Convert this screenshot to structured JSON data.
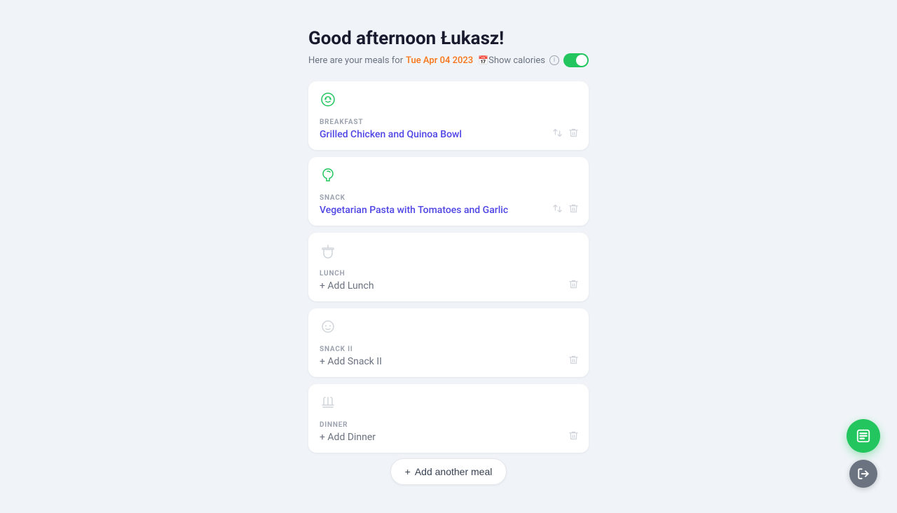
{
  "header": {
    "greeting": "Good afternoon Łukasz!",
    "subtitle_prefix": "Here are your meals for",
    "date": "Tue Apr 04 2023",
    "show_calories_label": "Show calories",
    "calories_toggle_on": true
  },
  "meals": [
    {
      "id": "breakfast",
      "type_label": "BREAKFAST",
      "meal_name": "Grilled Chicken and Quinoa Bowl",
      "is_empty": false,
      "icon": "breakfast-icon",
      "actions": [
        "swap",
        "delete"
      ]
    },
    {
      "id": "snack",
      "type_label": "SNACK",
      "meal_name": "Vegetarian Pasta with Tomatoes and Garlic",
      "is_empty": false,
      "icon": "snack-icon",
      "actions": [
        "swap",
        "delete"
      ]
    },
    {
      "id": "lunch",
      "type_label": "LUNCH",
      "meal_name": "+ Add Lunch",
      "is_empty": true,
      "icon": "lunch-icon",
      "actions": [
        "delete"
      ]
    },
    {
      "id": "snack-ii",
      "type_label": "SNACK II",
      "meal_name": "+ Add Snack II",
      "is_empty": true,
      "icon": "snack2-icon",
      "actions": [
        "delete"
      ]
    },
    {
      "id": "dinner",
      "type_label": "DINNER",
      "meal_name": "+ Add Dinner",
      "is_empty": true,
      "icon": "dinner-icon",
      "actions": [
        "delete"
      ]
    }
  ],
  "add_meal_button": "+ Add another meal",
  "fab": {
    "primary_icon": "list-icon",
    "secondary_icon": "exit-icon"
  }
}
